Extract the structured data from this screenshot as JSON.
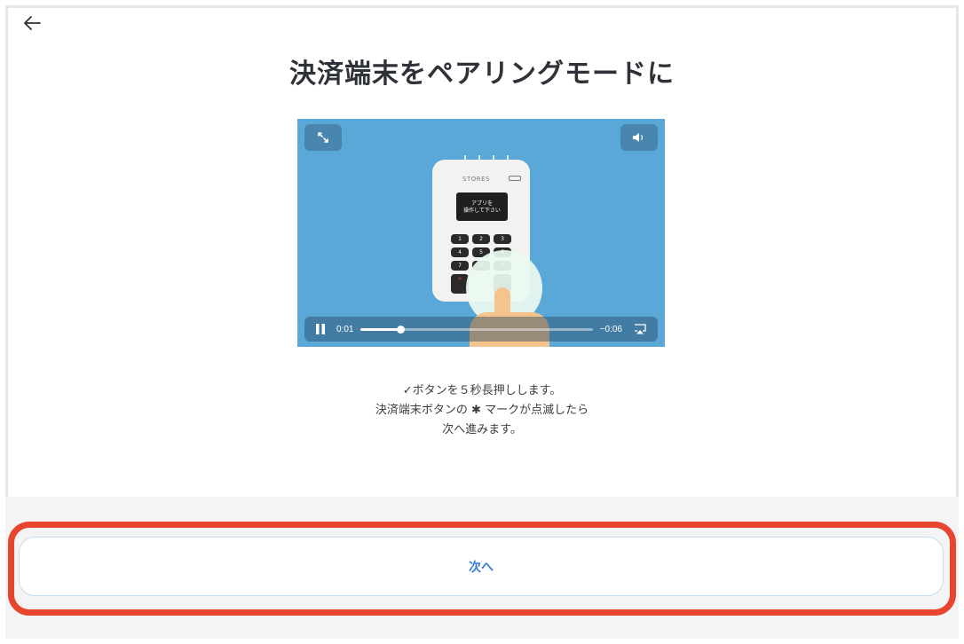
{
  "header": {
    "back_label": "",
    "title": "決済端末をペアリングモードに"
  },
  "video": {
    "terminal_brand": "STORES",
    "terminal_screen_line1": "アプリを",
    "terminal_screen_line2": "操作して下さい",
    "keys": [
      "1",
      "2",
      "3",
      "4",
      "5",
      "6",
      "7",
      "8",
      "9"
    ],
    "time_current": "0:01",
    "time_remaining": "−0:06",
    "progress_fraction": 0.17
  },
  "instructions": {
    "line1": "✓ボタンを５秒長押しします。",
    "line2": "決済端末ボタンの ✱ マークが点滅したら",
    "line3": "次へ進みます。"
  },
  "footer": {
    "next_label": "次へ"
  },
  "icons": {
    "back": "arrow-left-icon",
    "fullscreen": "expand-icon",
    "volume": "speaker-icon",
    "pause": "pause-icon",
    "airplay": "airplay-icon",
    "bluetooth": "bluetooth-icon"
  },
  "colors": {
    "video_bg": "#5aa8d8",
    "accent": "#3a7bd5",
    "highlight": "#e8452f"
  }
}
